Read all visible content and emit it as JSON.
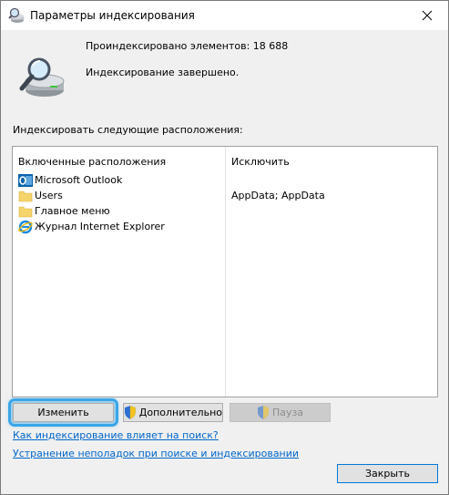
{
  "window": {
    "title": "Параметры индексирования"
  },
  "info": {
    "count_text": "Проиндексировано элементов: 18 688",
    "status_text": "Индексирование завершено."
  },
  "locations": {
    "section_label": "Индексировать следующие расположения:",
    "columns": {
      "included": "Включенные расположения",
      "excluded": "Исключить"
    },
    "rows": [
      {
        "icon": "outlook-icon",
        "label": "Microsoft Outlook",
        "exclude": ""
      },
      {
        "icon": "folder-icon",
        "label": "Users",
        "exclude": "AppData; AppData"
      },
      {
        "icon": "folder-icon",
        "label": "Главное меню",
        "exclude": ""
      },
      {
        "icon": "internet-explorer-icon",
        "label": "Журнал Internet Explorer",
        "exclude": ""
      }
    ]
  },
  "buttons": {
    "change": "Изменить",
    "advanced": "Дополнительно",
    "pause": "Пауза",
    "close": "Закрыть"
  },
  "links": {
    "how_indexing_affects": "Как индексирование влияет на поиск?",
    "troubleshoot": "Устранение неполадок при поиске и индексировании"
  },
  "colors": {
    "highlight": "#39a6e8",
    "link": "#0066cc",
    "folder": "#f5d46b"
  }
}
